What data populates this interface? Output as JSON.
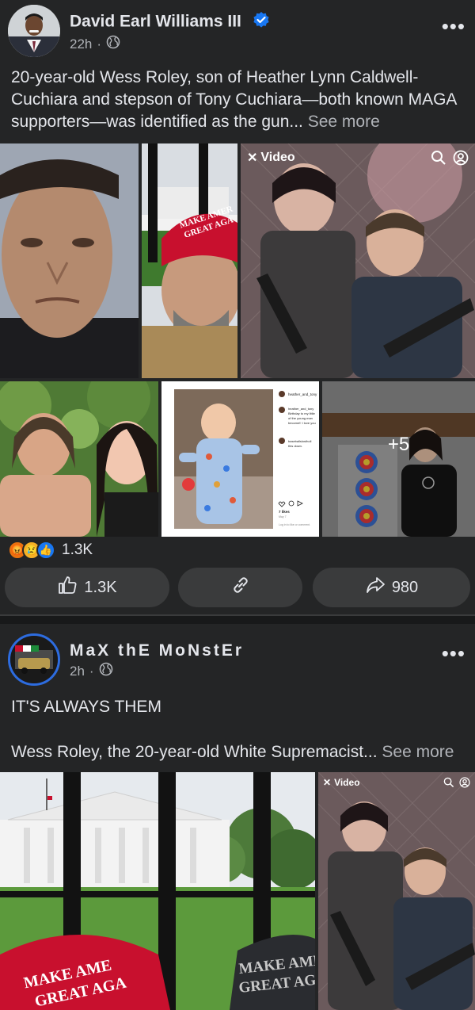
{
  "post1": {
    "author": "David Earl Williams III",
    "time": "22h",
    "dot": "·",
    "more_label": "•••",
    "text": "20-year-old Wess Roley, son of Heather Lynn Caldwell-Cuchiara and stepson of Tony Cuchiara—both known MAGA supporters—was identified as the gun... ",
    "see_more": "See more",
    "hat_text_line1": "MAKE AMER",
    "hat_text_line2": "GREAT AGA",
    "video_label": "Video",
    "insta_user": "heather_and_tony",
    "insta_caption_1": "Birthday to my little",
    "insta_caption_2": "of the young man",
    "insta_caption_3": "become!! I love you",
    "insta_user2": "baseballslostholl",
    "insta_caption_4": "this down.",
    "insta_likes": "7 likes",
    "insta_date": "May 7",
    "insta_login": "Log in to like or comment.",
    "more_photos": "+5",
    "reaction_count": "1.3K",
    "like_count": "1.3K",
    "share_count": "980"
  },
  "post2": {
    "author": "MaX thE MoNstEr",
    "time": "2h",
    "dot": "·",
    "more_label": "•••",
    "text_line1": "IT'S ALWAYS THEM",
    "text_line2": "Wess Roley, the 20-year-old White Supremacist... ",
    "see_more": "See more",
    "hat_text_line1": "MAKE AME",
    "hat_text_line2": "GREAT AGA",
    "hat2_text_line1": "MAKE AMER",
    "hat2_text_line2": "GREAT AGA",
    "video_label": "Video"
  },
  "colors": {
    "background": "#242526",
    "separator": "#18191a",
    "text_primary": "#e4e6eb",
    "text_secondary": "#b0b3b8",
    "button_bg": "#3a3b3c",
    "verified_blue": "#1877f2",
    "maga_red": "#c8102e"
  },
  "icons": [
    "globe-icon",
    "verified-badge-icon",
    "more-options-icon",
    "close-icon",
    "search-icon",
    "profile-icon",
    "angry-reaction-icon",
    "sad-reaction-icon",
    "like-reaction-icon",
    "like-icon",
    "link-icon",
    "share-icon"
  ]
}
